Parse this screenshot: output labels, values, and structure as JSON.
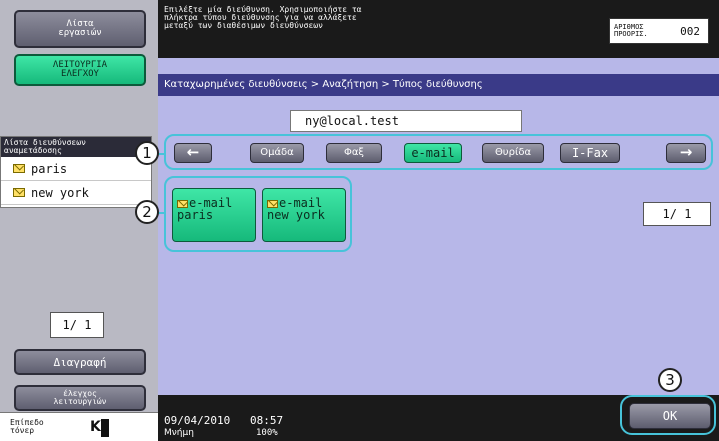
{
  "left": {
    "job_list_label": "Λίστα\nεργασιών",
    "check_function_label": "ΛΕΙΤΟΥΡΓΙΑ\nΕΛΕΓΧΟΥ",
    "history_title": "Λίστα διευθύνσεων\nαναμετάδοσης",
    "history_items": [
      "paris",
      "new york"
    ],
    "page": "1/ 1",
    "delete_label": "Διαγραφή",
    "check_operation_label": "έλεγχος\nλειτουργιών",
    "toner_label": "Επίπεδο\nτόνερ",
    "toner_color": "K"
  },
  "header": {
    "message": "Επιλέξτε μία διεύθυνση. Χρησιμοποιήστε τα\nπλήκτρα τύπου διεύθυνσης για να αλλάξετε\nμεταξύ των διαθέσιμων διευθύνσεων",
    "dest_label": "ΑΡΙΘΜΟΣ\nΠΡΟΟΡΙΣ.",
    "dest_count": "002"
  },
  "main": {
    "breadcrumb": "Καταχωρημένες διευθύνσεις > Αναζήτηση > Τύπος διεύθυνσης",
    "search_value": "ny@local.test",
    "type_buttons": [
      "Ομάδα",
      "Φαξ",
      "e-mail",
      "Θυρίδα",
      "I-Fax"
    ],
    "active_type": "e-mail",
    "results": [
      {
        "type": "e-mail",
        "name": "paris"
      },
      {
        "type": "e-mail",
        "name": "new york"
      }
    ],
    "result_page": "1/ 1"
  },
  "status": {
    "date": "09/04/2010",
    "time": "08:57",
    "memory_label": "Μνήμη",
    "memory_value": "100%"
  },
  "ok_label": "OK",
  "callouts": [
    "1",
    "2",
    "3"
  ],
  "colors": {
    "accent_green": "#16b97b",
    "breadcrumb_blue": "#3a3a88",
    "panel_lavender": "#b7b7e8",
    "callout_cyan": "#47c3d9"
  }
}
